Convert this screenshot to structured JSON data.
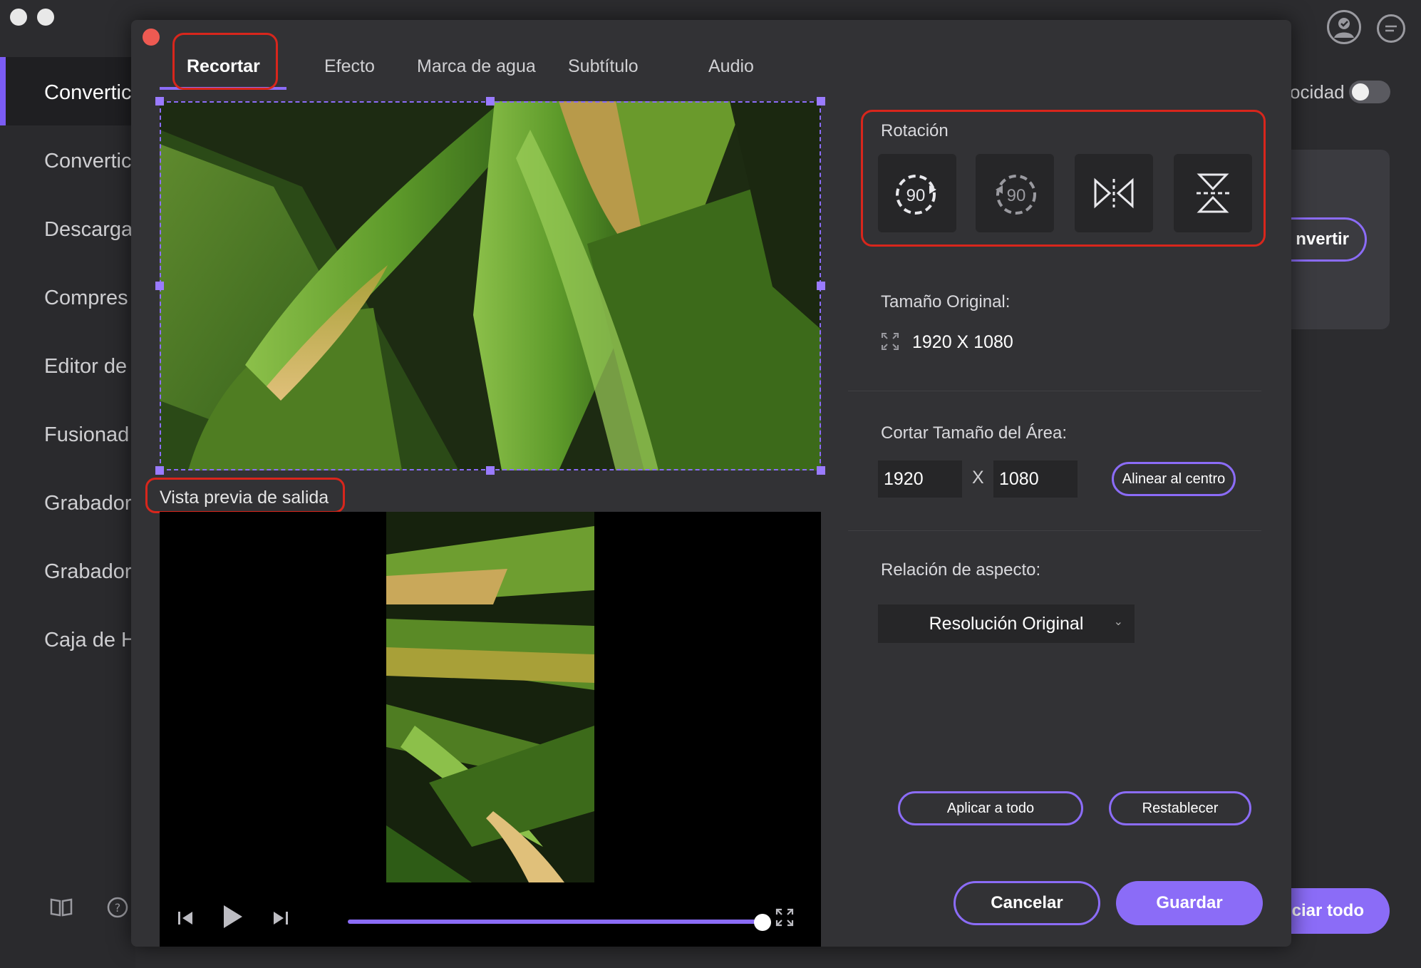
{
  "background": {
    "sidebar_items": [
      "Convertic",
      "Convertic",
      "Descarga",
      "Compres",
      "Editor de",
      "Fusionad",
      "Grabador",
      "Grabador",
      "Caja de H"
    ],
    "speed_label": "ocidad",
    "convert_button": "nvertir",
    "start_all_button": "ciar todo",
    "icons": {
      "book": "book-icon",
      "help": "help-icon",
      "account": "account-icon",
      "chat": "chat-icon"
    }
  },
  "tabs": [
    {
      "label": "Recortar",
      "active": true
    },
    {
      "label": "Efecto"
    },
    {
      "label": "Marca de agua"
    },
    {
      "label": "Subtítulo"
    },
    {
      "label": "Audio"
    }
  ],
  "output_preview_label": "Vista previa de salida",
  "player": {
    "progress": 1.0
  },
  "rotation": {
    "label": "Rotación",
    "buttons": [
      {
        "name": "rotate-clockwise",
        "text": "90"
      },
      {
        "name": "rotate-counterclockwise",
        "text": "90"
      },
      {
        "name": "flip-horizontal"
      },
      {
        "name": "flip-vertical"
      }
    ]
  },
  "original_size": {
    "label": "Tamaño Original:",
    "value": "1920 X 1080"
  },
  "crop_area": {
    "label": "Cortar Tamaño del Área:",
    "width": "1920",
    "separator": "X",
    "height": "1080",
    "align_center": "Alinear al centro"
  },
  "aspect_ratio": {
    "label": "Relación de aspecto:",
    "selected": "Resolución Original"
  },
  "actions": {
    "apply_all": "Aplicar a todo",
    "reset": "Restablecer",
    "cancel": "Cancelar",
    "save": "Guardar"
  },
  "colors": {
    "accent": "#8b6cf7",
    "annotation": "#d8261c",
    "panel": "#323235"
  }
}
